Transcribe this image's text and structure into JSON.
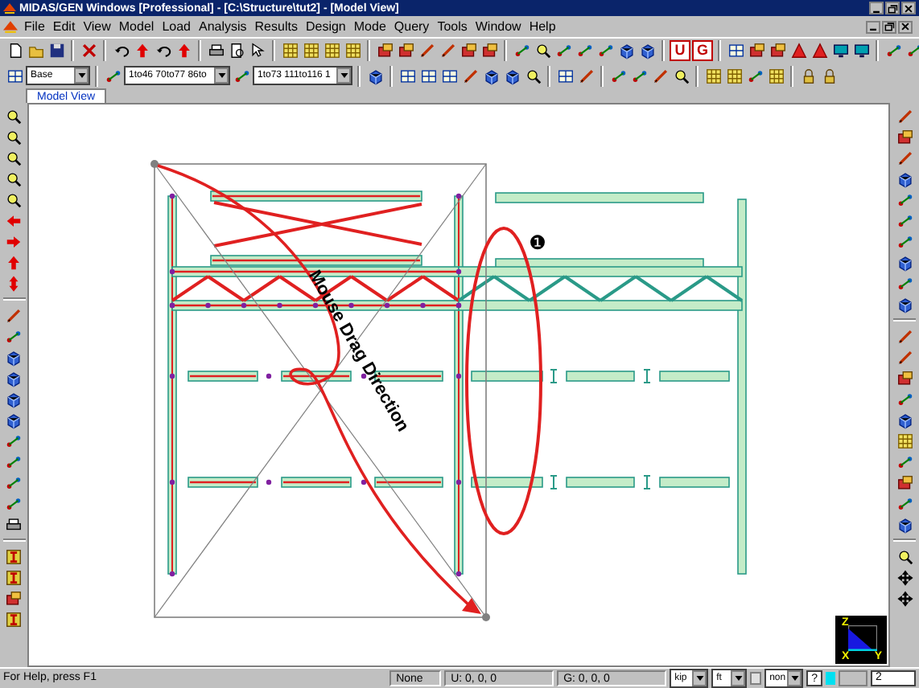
{
  "window": {
    "title": "MIDAS/GEN Windows [Professional] - [C:\\Structure\\tut2] - [Model View]"
  },
  "menu": [
    "File",
    "Edit",
    "View",
    "Model",
    "Load",
    "Analysis",
    "Results",
    "Design",
    "Mode",
    "Query",
    "Tools",
    "Window",
    "Help"
  ],
  "toolbar": {
    "letter_buttons": [
      "U",
      "G"
    ],
    "group_combo": "Base",
    "node_combo": "1to46 70to77 86to",
    "element_combo": "1to73 111to116 1"
  },
  "tabs": [
    {
      "label": "Model View",
      "selected": true
    }
  ],
  "canvas": {
    "annotation": "Mouse Drag Direction",
    "callout": "❶",
    "axes": [
      "Z",
      "X",
      "Y"
    ]
  },
  "status_bar": {
    "help": "For Help, press F1",
    "selection": "None",
    "ucs": "U: 0, 0, 0",
    "global": "G: 0, 0, 0",
    "force_unit": "kip",
    "length_unit": "ft",
    "snap": "non",
    "toggle_checked": false,
    "help_button": "?",
    "value": "2"
  }
}
